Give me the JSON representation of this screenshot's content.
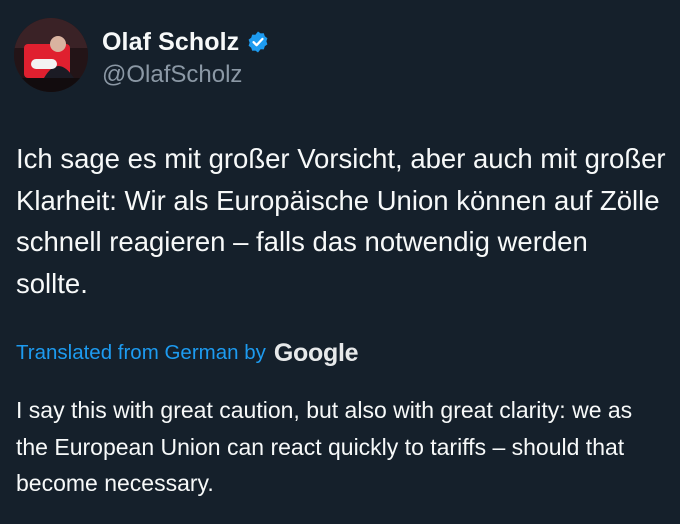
{
  "tweet": {
    "author": {
      "display_name": "Olaf Scholz",
      "handle": "@OlafScholz",
      "verified": true,
      "verified_color": "#1d9bf0"
    },
    "text": "Ich sage es mit großer Vorsicht, aber auch mit großer Klarheit: Wir als Europäische Union können auf Zölle schnell reagieren – falls das notwendig werden sollte.",
    "translation": {
      "label": "Translated from German by",
      "provider": "Google",
      "text": "I say this with great caution, but also with great clarity: we as the European Union can react quickly to tariffs – should that become necessary."
    }
  },
  "colors": {
    "background": "#15202b",
    "text": "#f7f9f9",
    "secondary_text": "#8b98a5",
    "accent": "#1d9bf0"
  }
}
